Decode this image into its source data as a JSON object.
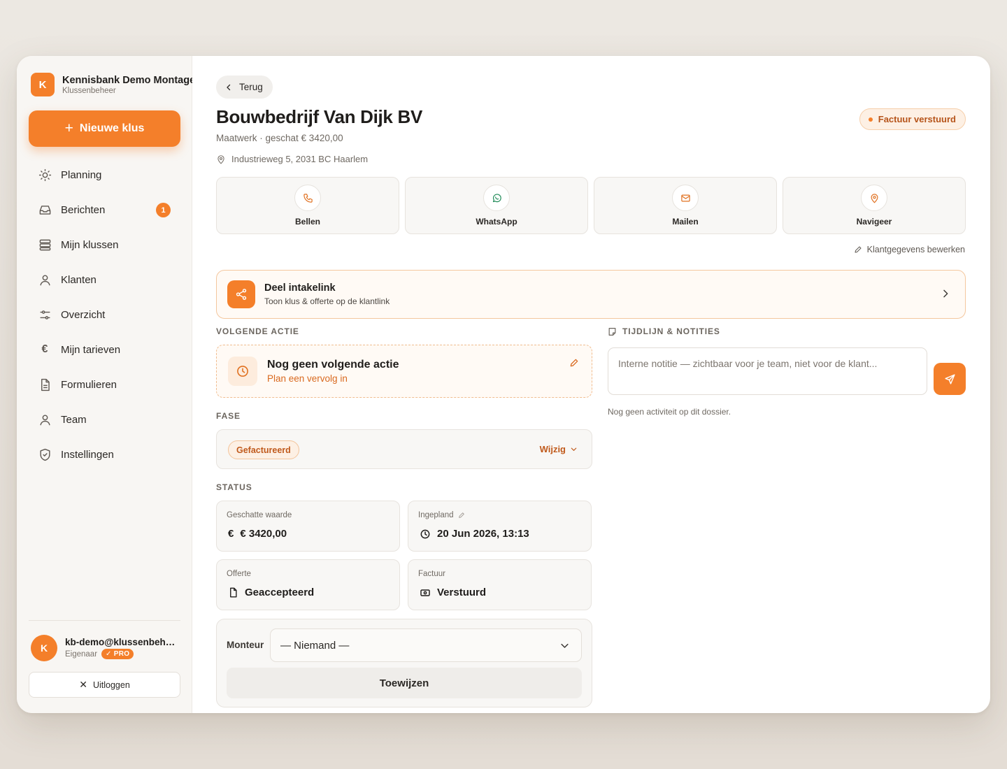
{
  "sidebar": {
    "brand": {
      "initial": "K",
      "name": "Kennisbank Demo Montage",
      "subtitle": "Klussenbeheer"
    },
    "new_button": {
      "label": "Nieuwe klus"
    },
    "items": [
      {
        "label": "Planning",
        "icon": "sun-icon"
      },
      {
        "label": "Berichten",
        "icon": "inbox-icon",
        "badge": "1"
      },
      {
        "label": "Mijn klussen",
        "icon": "stack-icon"
      },
      {
        "label": "Klanten",
        "icon": "user-icon"
      },
      {
        "label": "Overzicht",
        "icon": "sliders-icon"
      },
      {
        "label": "Mijn tarieven",
        "icon": "euro-icon"
      },
      {
        "label": "Formulieren",
        "icon": "document-icon"
      },
      {
        "label": "Team",
        "icon": "user-icon"
      },
      {
        "label": "Instellingen",
        "icon": "shield-icon"
      }
    ],
    "user": {
      "initial": "K",
      "email": "kb-demo@klussenbeheer.nl",
      "role": "Eigenaar",
      "plan": "PRO"
    },
    "logout_label": "Uitloggen"
  },
  "header": {
    "back_label": "Terug",
    "title": "Bouwbedrijf Van Dijk BV",
    "subtitle": "Maatwerk · geschat € 3420,00",
    "address": "Industrieweg 5, 2031 BC Haarlem",
    "status": "Factuur verstuurd"
  },
  "actions": [
    {
      "label": "Bellen",
      "icon": "phone-icon"
    },
    {
      "label": "WhatsApp",
      "icon": "whatsapp-icon"
    },
    {
      "label": "Mailen",
      "icon": "mail-icon"
    },
    {
      "label": "Navigeer",
      "icon": "map-pin-icon"
    }
  ],
  "edit_customer_label": "Klantgegevens bewerken",
  "intake": {
    "title": "Deel intakelink",
    "subtitle": "Toon klus & offerte op de klantlink"
  },
  "next_action": {
    "section": "VOLGENDE ACTIE",
    "title": "Nog geen volgende actie",
    "subtitle": "Plan een vervolg in"
  },
  "phase": {
    "section": "FASE",
    "value": "Gefactureerd",
    "change_label": "Wijzig"
  },
  "status": {
    "section": "STATUS",
    "cards": {
      "value": {
        "label": "Geschatte waarde",
        "value": "€ 3420,00",
        "icon": "euro-icon"
      },
      "planned": {
        "label": "Ingepland",
        "value": "20 Jun 2026, 13:13",
        "icon": "clock-icon"
      },
      "quote": {
        "label": "Offerte",
        "value": "Geaccepteerd",
        "icon": "file-icon"
      },
      "invoice": {
        "label": "Factuur",
        "value": "Verstuurd",
        "icon": "banknote-icon"
      }
    }
  },
  "assign": {
    "label": "Monteur",
    "selected": "— Niemand —",
    "button": "Toewijzen"
  },
  "timeline": {
    "section": "TIJDLIJN & NOTITIES",
    "placeholder": "Interne notitie — zichtbaar voor je team, niet voor de klant...",
    "empty": "Nog geen activiteit op dit dossier."
  },
  "colors": {
    "accent": "#f47f2a",
    "accent_dark": "#c05a1c",
    "whatsapp": "#1f8a57"
  }
}
